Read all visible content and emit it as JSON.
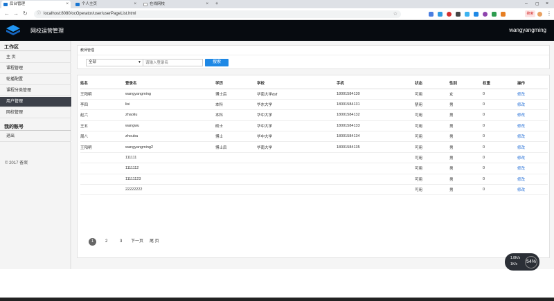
{
  "browser": {
    "tabs": [
      {
        "label": "后台管理",
        "active": true
      },
      {
        "label": "个人主页",
        "active": false
      },
      {
        "label": "在线网校",
        "active": false
      }
    ],
    "new_tab": "+",
    "url": "localhost:8080/ocOperator/user/userPageList.html",
    "ext_badge": "搜索"
  },
  "header": {
    "title": "网校运营管理",
    "username": "wangyangming"
  },
  "sidebar": {
    "section1": "工作区",
    "items": [
      {
        "label": "主 页",
        "active": false
      },
      {
        "label": "课程管理",
        "active": false
      },
      {
        "label": "轮播配置",
        "active": false
      },
      {
        "label": "课程分类管理",
        "active": false
      },
      {
        "label": "用户管理",
        "active": true
      },
      {
        "label": "网校管理",
        "active": false
      }
    ],
    "section2": "我的账号",
    "account_items": [
      {
        "label": "退出"
      }
    ],
    "copyright": "© 2017  备案"
  },
  "filter": {
    "panel_title": "教师管理",
    "select_value": "全部",
    "search_placeholder": "请输入登录名",
    "search_button": "搜索"
  },
  "table": {
    "columns": [
      "姓名",
      "登录名",
      "学历",
      "学校",
      "手机",
      "状态",
      "性别",
      "权重",
      "操作"
    ],
    "rows": [
      [
        "王阳明",
        "wangyangming",
        "博士后",
        "华南大学dsf",
        "18001584130",
        "可用",
        "女",
        "0",
        "修改"
      ],
      [
        "李四",
        "lisi",
        "本科",
        "华东大学",
        "18001584131",
        "禁用",
        "男",
        "0",
        "修改"
      ],
      [
        "赵六",
        "zhaoliu",
        "本科",
        "华中大学",
        "18001584132",
        "可用",
        "男",
        "0",
        "修改"
      ],
      [
        "王五",
        "wangwu",
        "硕士",
        "华中大学",
        "18001584133",
        "可用",
        "男",
        "0",
        "修改"
      ],
      [
        "周八",
        "zhouba",
        "博士",
        "华中大学",
        "18001584134",
        "可用",
        "男",
        "0",
        "修改"
      ],
      [
        "王阳明",
        "wangyangming2",
        "博士后",
        "华南大学",
        "18001584135",
        "可用",
        "男",
        "0",
        "修改"
      ],
      [
        "",
        "111111",
        "",
        "",
        "",
        "可用",
        "男",
        "0",
        "修改"
      ],
      [
        "",
        "1111112",
        "",
        "",
        "",
        "可用",
        "男",
        "0",
        "修改"
      ],
      [
        "",
        "11111123",
        "",
        "",
        "",
        "可用",
        "男",
        "0",
        "修改"
      ],
      [
        "",
        "22222222",
        "",
        "",
        "",
        "可用",
        "男",
        "0",
        "修改"
      ]
    ]
  },
  "pagination": {
    "pages": [
      "1",
      "2",
      "3"
    ],
    "current": "1",
    "next": "下一页",
    "last": "尾 页"
  },
  "widget": {
    "line1": "1.8K/s",
    "line2": "1K/s",
    "percent": "54%"
  },
  "colors": {
    "header_bg": "#070b10",
    "accent": "#1e88e5",
    "active_nav": "#3c4049",
    "link": "#1e6bd6"
  }
}
